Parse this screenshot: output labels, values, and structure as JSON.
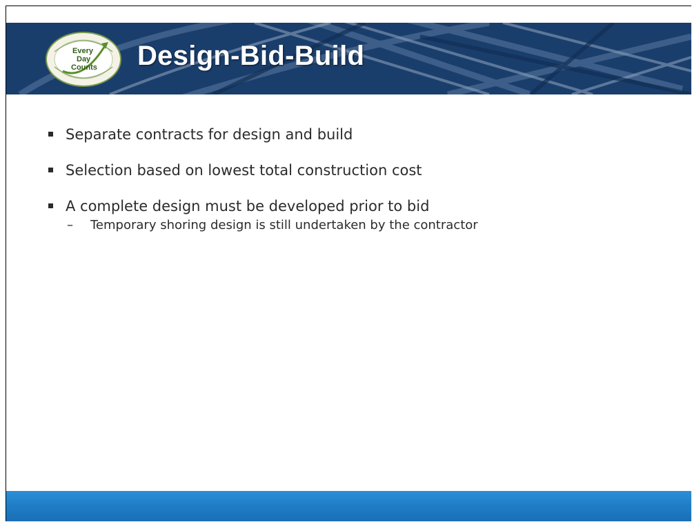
{
  "slide": {
    "title": "Design-Bid-Build",
    "logo": {
      "icon": "every-day-counts-logo",
      "text": [
        "Every",
        "Day",
        "Counts"
      ]
    },
    "bullets": [
      {
        "text": "Separate contracts for design and build",
        "subs": []
      },
      {
        "text": "Selection based on lowest total construction cost",
        "subs": []
      },
      {
        "text": "A complete design must be developed prior to bid",
        "subs": [
          "Temporary shoring design is still undertaken by the contractor"
        ]
      }
    ],
    "sub_marker": "–"
  },
  "colors": {
    "header_bg": "#1b3c68",
    "footer_bg": "#1f7dc6",
    "text": "#2b2b2b",
    "logo_green": "#5a8f2a"
  }
}
